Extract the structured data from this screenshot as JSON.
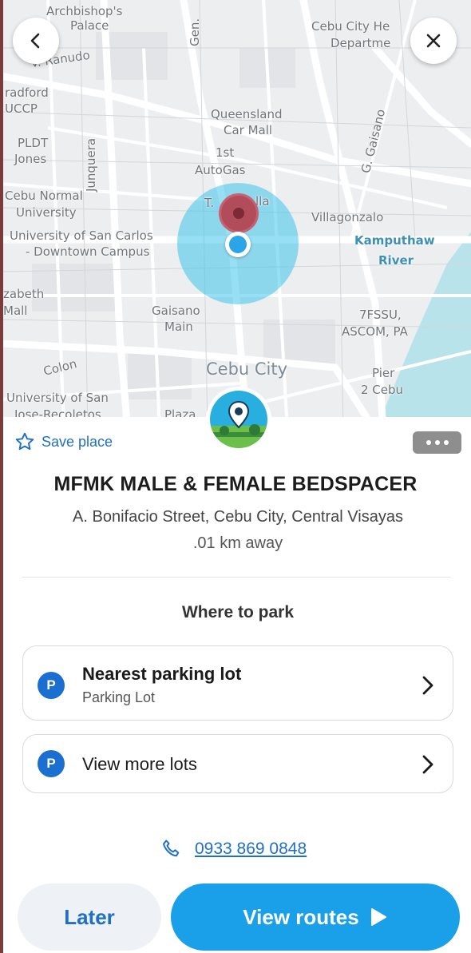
{
  "map": {
    "labels": {
      "archbishops": "Archbishop's",
      "palace": "Palace",
      "ranudo": "V. Ranudo",
      "gen": "Gen.",
      "cebu_city_he": "Cebu City He",
      "departme": "Departme",
      "radford": "radford",
      "uccp": "UCCP",
      "queensland": "Queensland",
      "car_mall": "Car Mall",
      "pldt": "PLDT",
      "jones": "Jones",
      "junquera": "Junquera",
      "gaisano_street": "G. Gaisano",
      "first": "1st",
      "autogas": "AutoGas",
      "cebu_normal": "Cebu Normal",
      "university": "University",
      "t_illa_t": "T.",
      "t_illa_b": "lla",
      "villagonzalo": "Villagonzalo",
      "usc": "University of San Carlos",
      "downtown": "- Downtown Campus",
      "kamputhaw": "Kamputhaw",
      "river": "River",
      "zabeth": "zabeth",
      "mall": "Mall",
      "gaisano": "Gaisano",
      "main": "Main",
      "fssu": "7FSSU,",
      "ascom": "ASCOM, PA",
      "colon": "Colon",
      "cebu_city": "Cebu City",
      "pier": "Pier",
      "pier2": "2 Cebu",
      "usj1": "University of San",
      "usj2": "Jose-Recoletos",
      "plaza": "Plaza"
    }
  },
  "nav": {
    "back_icon": "chevron-left-icon",
    "close_icon": "close-icon"
  },
  "place": {
    "save_label": "Save place",
    "more_icon": "ellipsis-icon",
    "name": "MFMK MALE & FEMALE BEDSPACER",
    "address": "A. Bonifacio Street, Cebu City, Central Visayas",
    "distance": ".01 km away"
  },
  "parking": {
    "heading": "Where to park",
    "badge": "P",
    "lots": [
      {
        "title": "Nearest parking lot",
        "subtitle": "Parking Lot"
      },
      {
        "title": "View more lots",
        "subtitle": ""
      }
    ]
  },
  "contact": {
    "phone": "0933 869 0848"
  },
  "actions": {
    "later_label": "Later",
    "routes_label": "View routes"
  },
  "colors": {
    "accent_blue": "#1aa0e8",
    "link_blue": "#1f6fc5",
    "pin_red": "#b14c5a",
    "accuracy_cyan": "#40c4eb"
  }
}
